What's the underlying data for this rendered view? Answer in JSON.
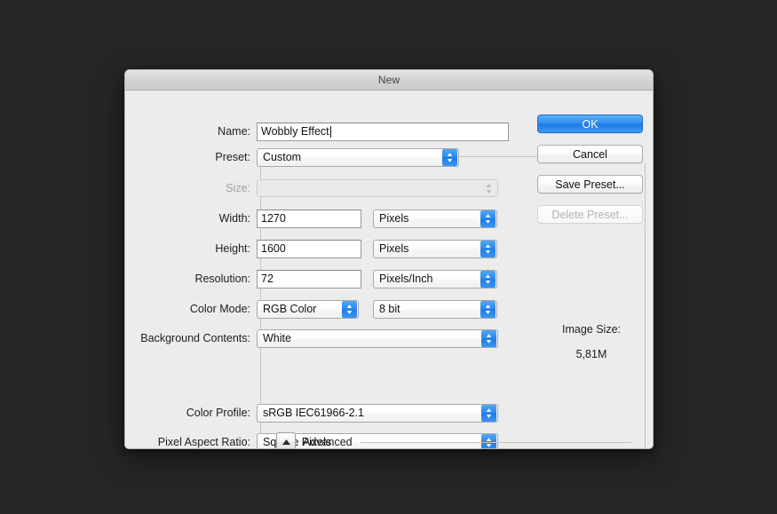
{
  "window": {
    "title": "New"
  },
  "fields": {
    "name": {
      "label": "Name:",
      "value": "Wobbly Effect"
    },
    "preset": {
      "label": "Preset:",
      "value": "Custom"
    },
    "size": {
      "label": "Size:",
      "value": ""
    },
    "width": {
      "label": "Width:",
      "value": "1270",
      "unit": "Pixels"
    },
    "height": {
      "label": "Height:",
      "value": "1600",
      "unit": "Pixels"
    },
    "resolution": {
      "label": "Resolution:",
      "value": "72",
      "unit": "Pixels/Inch"
    },
    "color_mode": {
      "label": "Color Mode:",
      "value": "RGB Color",
      "depth": "8 bit"
    },
    "background_contents": {
      "label": "Background Contents:",
      "value": "White"
    },
    "color_profile": {
      "label": "Color Profile:",
      "value": "sRGB IEC61966-2.1"
    },
    "pixel_aspect_ratio": {
      "label": "Pixel Aspect Ratio:",
      "value": "Square Pixels"
    }
  },
  "advanced": {
    "label": "Advanced",
    "expanded": true
  },
  "buttons": {
    "ok": "OK",
    "cancel": "Cancel",
    "save_preset": "Save Preset...",
    "delete_preset": "Delete Preset..."
  },
  "image_size": {
    "title": "Image Size:",
    "value": "5,81M"
  },
  "colors": {
    "accent_blue": "#2f8df0",
    "dialog_bg": "#ececec",
    "page_bg": "#262626"
  }
}
